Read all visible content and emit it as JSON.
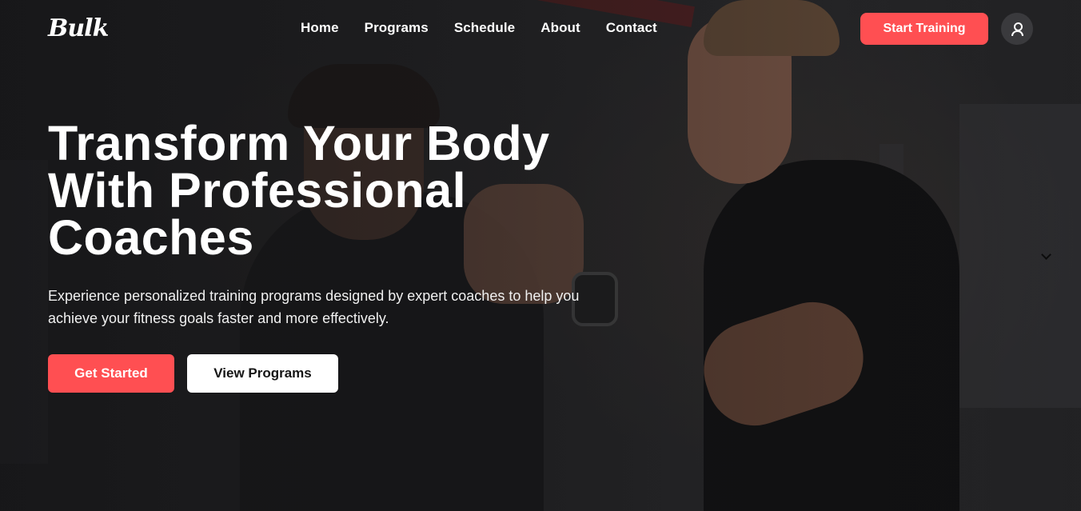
{
  "header": {
    "logo": "Bulk",
    "nav": [
      "Home",
      "Programs",
      "Schedule",
      "About",
      "Contact"
    ],
    "cta_label": "Start Training",
    "user_icon": "user-icon"
  },
  "hero": {
    "title": "Transform Your Body With Professional Coaches",
    "description": "Experience personalized training programs designed by expert coaches to help you achieve your fitness goals faster and more effectively.",
    "primary_button": "Get Started",
    "secondary_button": "View Programs"
  },
  "colors": {
    "accent": "#ff4f52",
    "background": "#1d1d1f",
    "text": "#ffffff"
  }
}
